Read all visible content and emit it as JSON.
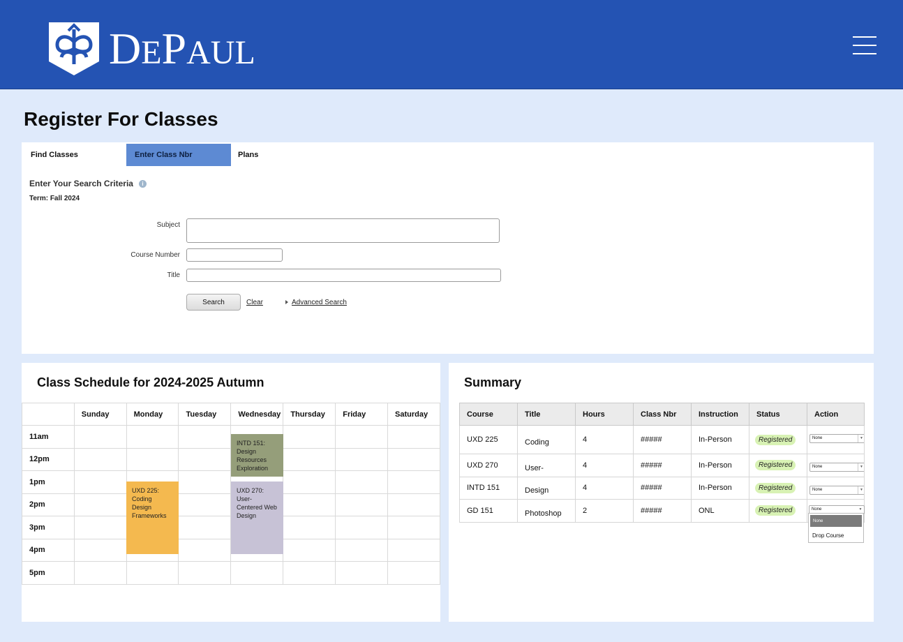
{
  "header": {
    "brand": "DEPAUL",
    "logo_icon": "depaul-shield-logo",
    "menu_icon": "hamburger-menu-icon",
    "bg_color": "#2453b3"
  },
  "page_title": "Register For Classes",
  "search": {
    "tabs": [
      "Find Classes",
      "Enter Class Nbr",
      "Plans"
    ],
    "active_tab": "Enter Class Nbr",
    "criteria_heading": "Enter Your Search Criteria",
    "term": "Term: Fall 2024",
    "subject_label": "Subject",
    "subject_value": "",
    "course_number_label": "Course Number",
    "course_number_value": "",
    "title_label": "Title",
    "title_value": "",
    "search_button": "Search",
    "clear_link": "Clear",
    "advanced_link": "Advanced Search"
  },
  "schedule": {
    "title": "Class Schedule for 2024-2025 Autumn",
    "days": [
      "Sunday",
      "Monday",
      "Tuesday",
      "Wednesday",
      "Thursday",
      "Friday",
      "Saturday"
    ],
    "times": [
      "11am",
      "12pm",
      "1pm",
      "2pm",
      "3pm",
      "4pm",
      "5pm"
    ],
    "events": [
      {
        "label": "UXD 225: Coding Design Frameworks",
        "day": "Monday",
        "color": "#f4b94f"
      },
      {
        "label": "INTD 151: Design Resources Exploration",
        "day": "Wednesday",
        "color": "#959e7a"
      },
      {
        "label": "UXD 270: User-Centered Web Design",
        "day": "Wednesday",
        "color": "#c7c2d6"
      }
    ]
  },
  "summary": {
    "title": "Summary",
    "columns": [
      "Course",
      "Title",
      "Hours",
      "Class Nbr",
      "Instruction",
      "Status",
      "Action"
    ],
    "rows": [
      {
        "course": "UXD 225",
        "title": "Coding Design Frameworks",
        "hours": "4",
        "class_nbr": "#####",
        "instruction": "In-Person",
        "status": "Registered",
        "action": "None"
      },
      {
        "course": "UXD 270",
        "title": "User-Centered Web Design",
        "hours": "4",
        "class_nbr": "#####",
        "instruction": "In-Person",
        "status": "Registered",
        "action": "None"
      },
      {
        "course": "INTD 151",
        "title": "Design Resources",
        "hours": "4",
        "class_nbr": "#####",
        "instruction": "In-Person",
        "status": "Registered",
        "action": "None"
      },
      {
        "course": "GD 151",
        "title": "Photoshop Workshop",
        "hours": "2",
        "class_nbr": "#####",
        "instruction": "ONL",
        "status": "Registered",
        "action": "None"
      }
    ],
    "dropdown_options": [
      "None",
      "Drop Course"
    ]
  }
}
